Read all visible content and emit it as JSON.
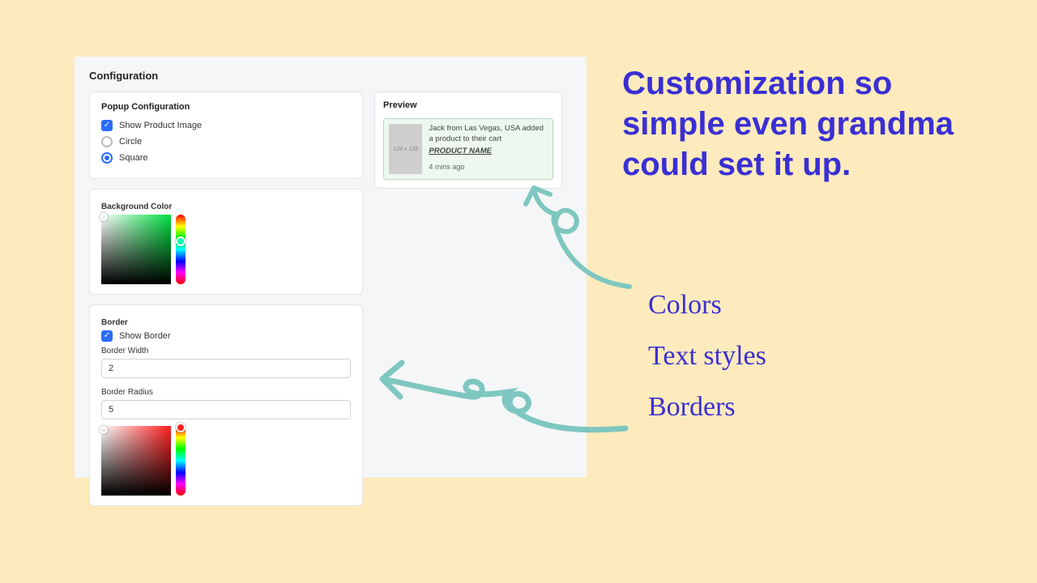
{
  "config": {
    "title": "Configuration",
    "popup": {
      "title": "Popup Configuration",
      "show_image_label": "Show Product Image",
      "show_image_checked": true,
      "shape_options": {
        "circle": "Circle",
        "square": "Square"
      },
      "shape_selected": "square"
    },
    "bg": {
      "label": "Background Color"
    },
    "border": {
      "title": "Border",
      "show_border_label": "Show Border",
      "show_border_checked": true,
      "width_label": "Border Width",
      "width_value": "2",
      "radius_label": "Border Radius",
      "radius_value": "5"
    }
  },
  "preview": {
    "title": "Preview",
    "thumb_placeholder": "128 x 128",
    "message": "Jack from Las Vegas, USA added a product to their cart",
    "product": "PRODUCT NAME",
    "time": "4 mins ago"
  },
  "marketing": {
    "headline": "Customization so simple even grandma could set it up.",
    "bullets": [
      "Colors",
      "Text styles",
      "Borders"
    ]
  }
}
